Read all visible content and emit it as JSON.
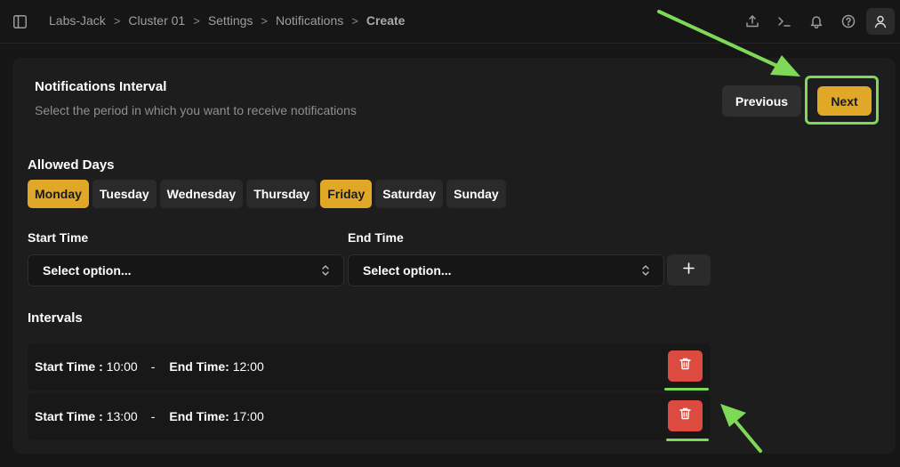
{
  "breadcrumb": {
    "items": [
      "Labs-Jack",
      "Cluster 01",
      "Settings",
      "Notifications"
    ],
    "current": "Create",
    "separator": ">"
  },
  "toolbar": {
    "icons": [
      "upload-icon",
      "terminal-icon",
      "bell-icon",
      "help-icon",
      "user-icon"
    ]
  },
  "card": {
    "title": "Notifications Interval",
    "subtitle": "Select the period in which you want to receive notifications",
    "previous_label": "Previous",
    "next_label": "Next"
  },
  "allowed_days": {
    "label": "Allowed Days",
    "days": [
      {
        "label": "Monday",
        "selected": true
      },
      {
        "label": "Tuesday",
        "selected": false
      },
      {
        "label": "Wednesday",
        "selected": false
      },
      {
        "label": "Thursday",
        "selected": false
      },
      {
        "label": "Friday",
        "selected": true
      },
      {
        "label": "Saturday",
        "selected": false
      },
      {
        "label": "Sunday",
        "selected": false
      }
    ]
  },
  "time_fields": {
    "start_label": "Start Time",
    "end_label": "End Time",
    "start_value": "Select option...",
    "end_value": "Select option...",
    "add_label": "+"
  },
  "intervals": {
    "label": "Intervals",
    "start_key": "Start Time",
    "end_key": "End Time",
    "dash": "-",
    "rows": [
      {
        "start": "10:00",
        "end": "12:00"
      },
      {
        "start": "13:00",
        "end": "17:00"
      }
    ]
  },
  "colors": {
    "accent": "#e0a826",
    "danger": "#dc4a40",
    "highlight": "#7ed957",
    "background": "#161616",
    "card": "#1d1d1d"
  }
}
